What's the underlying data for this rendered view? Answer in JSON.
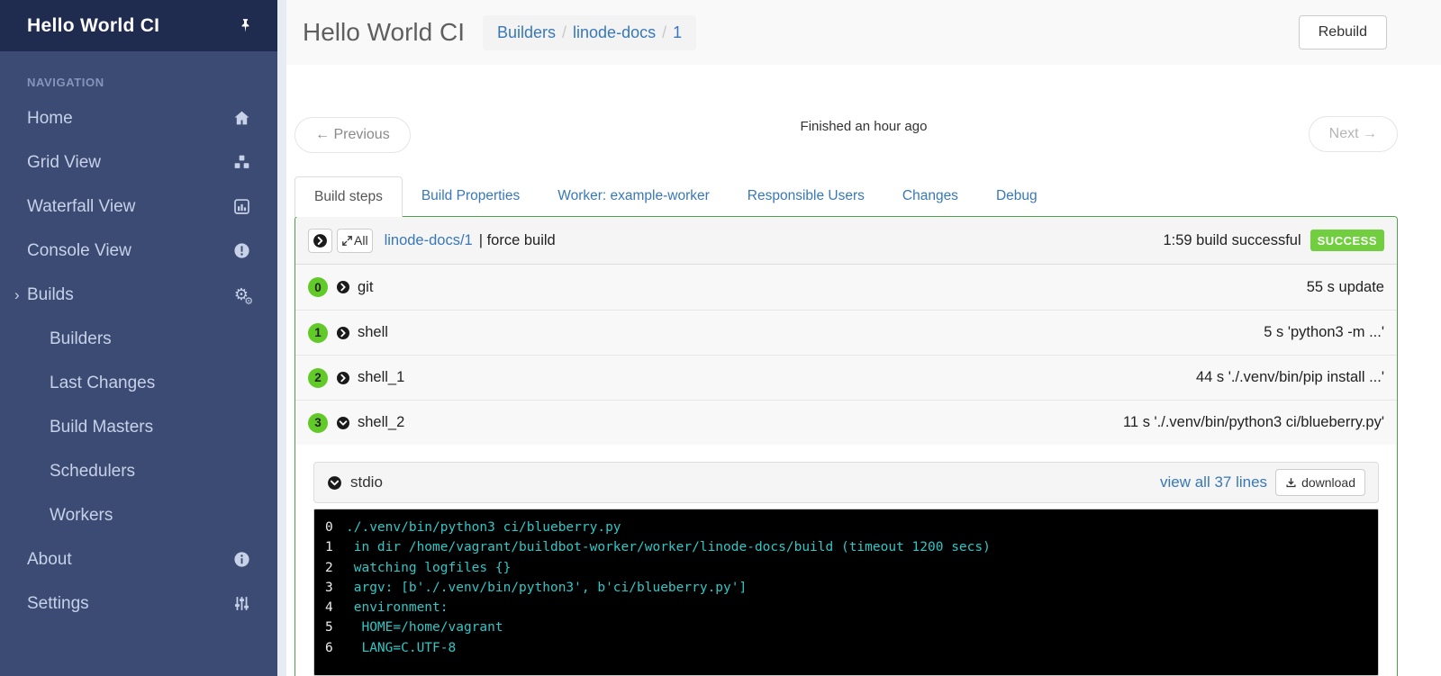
{
  "app": {
    "title": "Hello World CI"
  },
  "sidebar": {
    "section_label": "NAVIGATION",
    "items": [
      {
        "label": "Home",
        "icon": "home"
      },
      {
        "label": "Grid View",
        "icon": "cubes"
      },
      {
        "label": "Waterfall View",
        "icon": "bar-chart"
      },
      {
        "label": "Console View",
        "icon": "exclamation-circle"
      },
      {
        "label": "Builds",
        "icon": "gears",
        "expander": "›"
      },
      {
        "label": "Builders",
        "child": true
      },
      {
        "label": "Last Changes",
        "child": true
      },
      {
        "label": "Build Masters",
        "child": true
      },
      {
        "label": "Schedulers",
        "child": true
      },
      {
        "label": "Workers",
        "child": true
      },
      {
        "label": "About",
        "icon": "info-circle"
      },
      {
        "label": "Settings",
        "icon": "sliders"
      }
    ]
  },
  "header": {
    "title": "Hello World CI",
    "breadcrumb": [
      "Builders",
      "linode-docs",
      "1"
    ],
    "rebuild_label": "Rebuild"
  },
  "pager": {
    "previous_label": "← Previous",
    "status": "Finished an hour ago",
    "next_label": "Next →"
  },
  "tabs": [
    {
      "label": "Build steps",
      "active": true
    },
    {
      "label": "Build Properties",
      "active": false
    },
    {
      "label": "Worker: example-worker",
      "active": false
    },
    {
      "label": "Responsible Users",
      "active": false
    },
    {
      "label": "Changes",
      "active": false
    },
    {
      "label": "Debug",
      "active": false
    }
  ],
  "build_panel": {
    "collapse_all_label": "All",
    "builder_link": "linode-docs/1",
    "reason": "| force build",
    "duration_status": "1:59 build successful",
    "badge": "SUCCESS",
    "colors": {
      "panel_border": "#4f9d4f",
      "badge_bg": "#71ce3e",
      "step_number_bg": "#62ca28"
    },
    "steps": [
      {
        "number": "0",
        "name": "git",
        "detail": "55 s update",
        "expanded": false
      },
      {
        "number": "1",
        "name": "shell",
        "detail": "5 s 'python3 -m ...'",
        "expanded": false
      },
      {
        "number": "2",
        "name": "shell_1",
        "detail": "44 s './.venv/bin/pip install ...'",
        "expanded": false
      },
      {
        "number": "3",
        "name": "shell_2",
        "detail": "11 s './.venv/bin/python3 ci/blueberry.py'",
        "expanded": true
      }
    ]
  },
  "log": {
    "title": "stdio",
    "view_all_label": "view all 37 lines",
    "download_label": "download",
    "colors": {
      "background": "#000000",
      "text": "#2fc7c7",
      "line_number": "#ececec"
    },
    "lines": [
      {
        "n": "0",
        "text": "./.venv/bin/python3 ci/blueberry.py"
      },
      {
        "n": "1",
        "text": " in dir /home/vagrant/buildbot-worker/worker/linode-docs/build (timeout 1200 secs)"
      },
      {
        "n": "2",
        "text": " watching logfiles {}"
      },
      {
        "n": "3",
        "text": " argv: [b'./.venv/bin/python3', b'ci/blueberry.py']"
      },
      {
        "n": "4",
        "text": " environment:"
      },
      {
        "n": "5",
        "text": "  HOME=/home/vagrant"
      },
      {
        "n": "6",
        "text": "  LANG=C.UTF-8"
      }
    ]
  }
}
